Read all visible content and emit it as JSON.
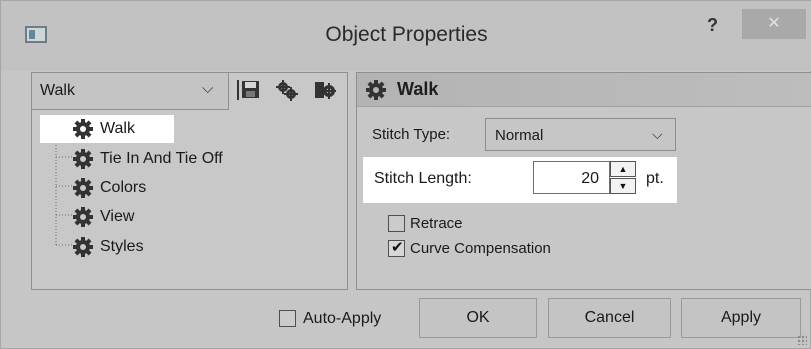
{
  "window": {
    "title": "Object Properties",
    "help_glyph": "?",
    "close_glyph": "✕"
  },
  "left_pane": {
    "combo_value": "Walk",
    "tree_items": [
      {
        "label": "Walk",
        "selected": true
      },
      {
        "label": "Tie In And Tie Off",
        "selected": false
      },
      {
        "label": "Colors",
        "selected": false
      },
      {
        "label": "View",
        "selected": false
      },
      {
        "label": "Styles",
        "selected": false
      }
    ],
    "toolbar_icons": [
      "save-icon",
      "gears-icon",
      "settings-export-icon"
    ]
  },
  "right_pane": {
    "header": "Walk",
    "stitch_type_label": "Stitch Type:",
    "stitch_type_value": "Normal",
    "stitch_length_label": "Stitch Length:",
    "stitch_length_value": "20",
    "stitch_length_unit": "pt.",
    "retrace_label": "Retrace",
    "retrace_checked": false,
    "curve_comp_label": "Curve Compensation",
    "curve_comp_checked": true
  },
  "footer": {
    "auto_apply_label": "Auto-Apply",
    "auto_apply_checked": false,
    "ok_label": "OK",
    "cancel_label": "Cancel",
    "apply_label": "Apply"
  },
  "colors": {
    "dialog_bg": "#c6c6c6",
    "highlight": "#ffffff",
    "close_button": "#a9a9a9"
  }
}
